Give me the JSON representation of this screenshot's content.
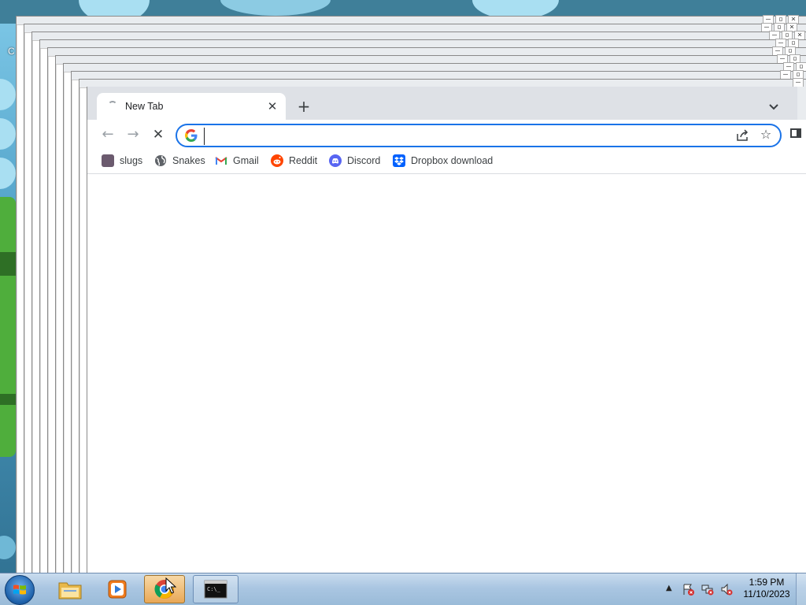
{
  "desktop": {
    "icon_label": "C"
  },
  "browser": {
    "tab": {
      "title": "New Tab",
      "close_glyph": "✕"
    },
    "new_tab_glyph": "+",
    "tab_search_glyph": "⌄",
    "toolbar": {
      "back_glyph": "←",
      "forward_glyph": "→",
      "stop_glyph": "✕",
      "omnibox_value": "",
      "star_glyph": "☆"
    },
    "bookmarks": [
      {
        "label": "slugs",
        "icon": "slug-favicon",
        "color": "#6b5a6e"
      },
      {
        "label": "Snakes",
        "icon": "globe-favicon",
        "color": "#5f6368"
      },
      {
        "label": "Gmail",
        "icon": "gmail-favicon",
        "color": "#ea4335"
      },
      {
        "label": "Reddit",
        "icon": "reddit-favicon",
        "color": "#ff4500"
      },
      {
        "label": "Discord",
        "icon": "discord-favicon",
        "color": "#5865f2"
      },
      {
        "label": "Dropbox download",
        "icon": "dropbox-favicon",
        "color": "#0061fe"
      }
    ]
  },
  "taskbar": {
    "buttons": [
      {
        "name": "file-explorer",
        "icon": "folder-icon"
      },
      {
        "name": "media-player",
        "icon": "media-player-icon"
      },
      {
        "name": "chrome",
        "icon": "chrome-icon",
        "active": true
      },
      {
        "name": "command-prompt",
        "icon": "cmd-icon"
      }
    ],
    "clock": {
      "time": "1:59 PM",
      "date": "11/10/2023"
    }
  }
}
